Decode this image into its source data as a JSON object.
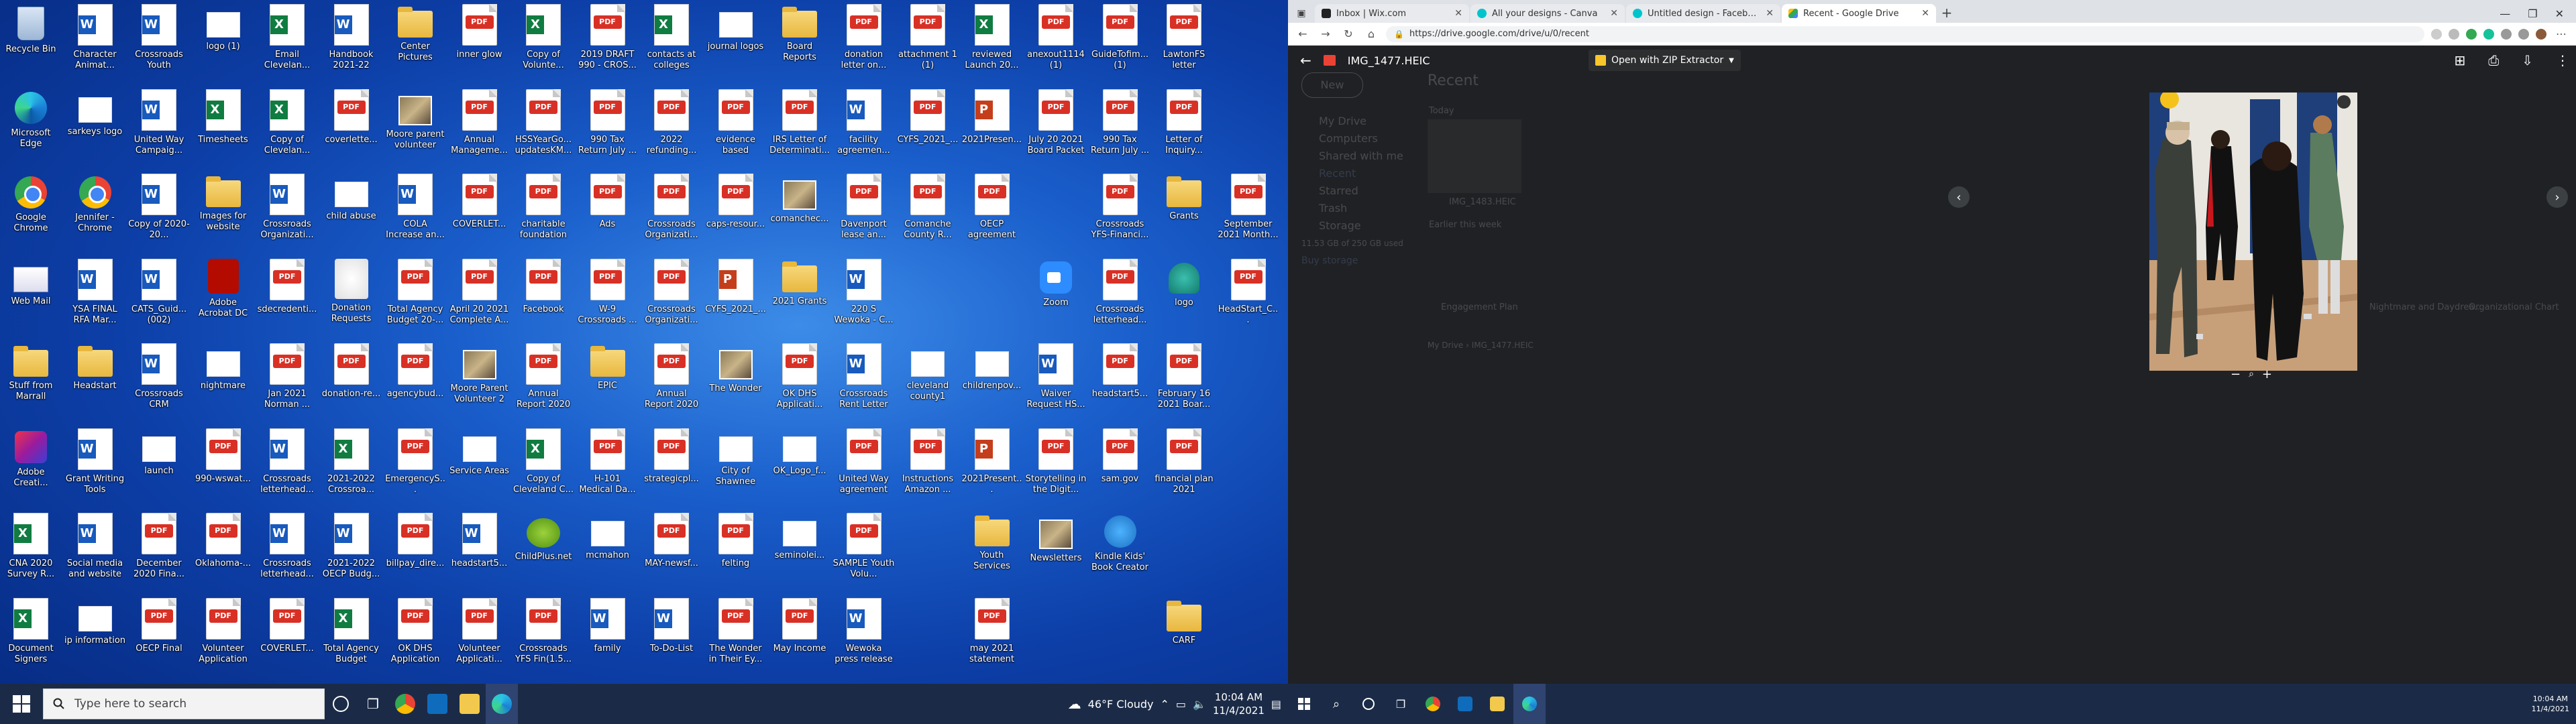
{
  "desktop": {
    "columns": [
      [
        {
          "label": "Recycle Bin",
          "icon": "bin"
        },
        {
          "label": "Microsoft Edge",
          "icon": "edge"
        },
        {
          "label": "Google Chrome",
          "icon": "chrome"
        },
        {
          "label": "Web Mail",
          "icon": "mail"
        },
        {
          "label": "Stuff from Marrall",
          "icon": "folder"
        },
        {
          "label": "Adobe Creati...",
          "icon": "adobe"
        },
        {
          "label": "CNA 2020 Survey R...",
          "icon": "excel"
        },
        {
          "label": "Document Signers",
          "icon": "excel"
        }
      ],
      [
        {
          "label": "Character Animat...",
          "icon": "word"
        },
        {
          "label": "sarkeys logo",
          "icon": "blank"
        },
        {
          "label": "Jennifer - Chrome",
          "icon": "chrome"
        },
        {
          "label": "YSA FINAL RFA Mar...",
          "icon": "word"
        },
        {
          "label": "Headstart",
          "icon": "folder"
        },
        {
          "label": "Grant Writing Tools",
          "icon": "word"
        },
        {
          "label": "Social media and website",
          "icon": "word"
        },
        {
          "label": "ip information",
          "icon": "blank"
        }
      ],
      [
        {
          "label": "Crossroads Youth",
          "icon": "word"
        },
        {
          "label": "United Way Campaig...",
          "icon": "word"
        },
        {
          "label": "Copy of 2020-20...",
          "icon": "word"
        },
        {
          "label": "CATS_Guid... (002)",
          "icon": "word"
        },
        {
          "label": "Crossroads CRM",
          "icon": "word"
        },
        {
          "label": "launch",
          "icon": "blank"
        },
        {
          "label": "December 2020 Fina...",
          "icon": "pdf"
        },
        {
          "label": "OECP Final",
          "icon": "pdf"
        }
      ],
      [
        {
          "label": "logo (1)",
          "icon": "blank"
        },
        {
          "label": "Timesheets",
          "icon": "excel"
        },
        {
          "label": "Images for website",
          "icon": "folder"
        },
        {
          "label": "Adobe Acrobat DC",
          "icon": "acrobat"
        },
        {
          "label": "nightmare",
          "icon": "blank"
        },
        {
          "label": "990-wswat...",
          "icon": "pdf"
        },
        {
          "label": "Oklahoma-...",
          "icon": "pdf"
        },
        {
          "label": "Volunteer Application",
          "icon": "pdf"
        }
      ],
      [
        {
          "label": "Email Clevelan...",
          "icon": "excel"
        },
        {
          "label": "Copy of Clevelan...",
          "icon": "excel"
        },
        {
          "label": "Crossroads Organizati...",
          "icon": "word"
        },
        {
          "label": "sdecredenti...",
          "icon": "pdf"
        },
        {
          "label": "Jan 2021 Norman ...",
          "icon": "pdf"
        },
        {
          "label": "Crossroads letterhead...",
          "icon": "word"
        },
        {
          "label": "Crossroads letterhead...",
          "icon": "word"
        },
        {
          "label": "COVERLET...",
          "icon": "pdf"
        }
      ],
      [
        {
          "label": "Handbook 2021-22",
          "icon": "word"
        },
        {
          "label": "coverlette...",
          "icon": "pdf"
        },
        {
          "label": "child abuse",
          "icon": "blank"
        },
        {
          "label": "Donation Requests",
          "icon": "nf"
        },
        {
          "label": "donation-re...",
          "icon": "pdf"
        },
        {
          "label": "2021-2022 Crossroa...",
          "icon": "excel"
        },
        {
          "label": "2021-2022 OECP Budg...",
          "icon": "word"
        },
        {
          "label": "Total Agency Budget",
          "icon": "excel"
        }
      ],
      [
        {
          "label": "Center Pictures",
          "icon": "folder"
        },
        {
          "label": "Moore parent volunteer",
          "icon": "img"
        },
        {
          "label": "COLA Increase an...",
          "icon": "word"
        },
        {
          "label": "Total Agency Budget 20-...",
          "icon": "pdf"
        },
        {
          "label": "agencybud...",
          "icon": "pdf"
        },
        {
          "label": "EmergencyS...",
          "icon": "pdf"
        },
        {
          "label": "billpay_dire...",
          "icon": "pdf"
        },
        {
          "label": "OK DHS Application",
          "icon": "pdf"
        }
      ],
      [
        {
          "label": "inner glow",
          "icon": "pdf"
        },
        {
          "label": "Annual Manageme...",
          "icon": "pdf"
        },
        {
          "label": "COVERLET...",
          "icon": "pdf"
        },
        {
          "label": "April 20 2021 Complete A...",
          "icon": "pdf"
        },
        {
          "label": "Moore Parent Volunteer 2",
          "icon": "img"
        },
        {
          "label": "Service Areas",
          "icon": "blank"
        },
        {
          "label": "headstart5...",
          "icon": "word"
        },
        {
          "label": "Volunteer Applicati...",
          "icon": "pdf"
        }
      ],
      [
        {
          "label": "Copy of Volunte...",
          "icon": "excel"
        },
        {
          "label": "HSSYearGo... updatesKM...",
          "icon": "pdf"
        },
        {
          "label": "charitable foundation",
          "icon": "pdf"
        },
        {
          "label": "Facebook",
          "icon": "pdf"
        },
        {
          "label": "Annual Report 2020",
          "icon": "pdf"
        },
        {
          "label": "Copy of Cleveland C...",
          "icon": "excel"
        },
        {
          "label": "ChildPlus.net",
          "icon": "net"
        },
        {
          "label": "Crossroads YFS Fin(1.5...",
          "icon": "pdf"
        }
      ],
      [
        {
          "label": "2019 DRAFT 990 - CROS...",
          "icon": "pdf"
        },
        {
          "label": "990 Tax Return July ...",
          "icon": "pdf"
        },
        {
          "label": "Ads",
          "icon": "pdf"
        },
        {
          "label": "W-9 Crossroads ...",
          "icon": "pdf"
        },
        {
          "label": "EPIC",
          "icon": "folder"
        },
        {
          "label": "H-101 Medical Da...",
          "icon": "pdf"
        },
        {
          "label": "mcmahon",
          "icon": "blank"
        },
        {
          "label": "family",
          "icon": "word"
        }
      ],
      [
        {
          "label": "contacts at colleges",
          "icon": "excel"
        },
        {
          "label": "2022 refunding...",
          "icon": "pdf"
        },
        {
          "label": "Crossroads Organizati...",
          "icon": "pdf"
        },
        {
          "label": "Crossroads Organizati...",
          "icon": "pdf"
        },
        {
          "label": "Annual Report 2020",
          "icon": "pdf"
        },
        {
          "label": "strategicpl...",
          "icon": "pdf"
        },
        {
          "label": "MAY-newsf...",
          "icon": "pdf"
        },
        {
          "label": "To-Do-List",
          "icon": "word"
        }
      ],
      [
        {
          "label": "journal logos",
          "icon": "blank"
        },
        {
          "label": "evidence based",
          "icon": "pdf"
        },
        {
          "label": "caps-resour...",
          "icon": "pdf"
        },
        {
          "label": "CYFS_2021_...",
          "icon": "ppt"
        },
        {
          "label": "The Wonder",
          "icon": "img"
        },
        {
          "label": "City of Shawnee",
          "icon": "blank"
        },
        {
          "label": "felting",
          "icon": "pdf"
        },
        {
          "label": "The Wonder in Their Ey...",
          "icon": "pdf"
        }
      ],
      [
        {
          "label": "Board Reports",
          "icon": "folder"
        },
        {
          "label": "IRS Letter of Determinati...",
          "icon": "pdf"
        },
        {
          "label": "comanchec...",
          "icon": "img"
        },
        {
          "label": "2021 Grants",
          "icon": "folder"
        },
        {
          "label": "OK DHS Applicati...",
          "icon": "pdf"
        },
        {
          "label": "OK_Logo_f...",
          "icon": "blank"
        },
        {
          "label": "seminolei...",
          "icon": "blank"
        },
        {
          "label": "May Income",
          "icon": "pdf"
        }
      ],
      [
        {
          "label": "donation letter on...",
          "icon": "pdf"
        },
        {
          "label": "facility agreemen...",
          "icon": "word"
        },
        {
          "label": "Davenport lease an...",
          "icon": "pdf"
        },
        {
          "label": "220 S Wewoka - C...",
          "icon": "word"
        },
        {
          "label": "Crossroads Rent Letter",
          "icon": "word"
        },
        {
          "label": "United Way agreement",
          "icon": "pdf"
        },
        {
          "label": "SAMPLE Youth Volu...",
          "icon": "pdf"
        },
        {
          "label": "Wewoka press release",
          "icon": "word"
        }
      ],
      [
        {
          "label": "attachment 1 (1)",
          "icon": "pdf"
        },
        {
          "label": "CYFS_2021_...",
          "icon": "pdf"
        },
        {
          "label": "Comanche County R...",
          "icon": "pdf"
        },
        {
          "label": "",
          "icon": "none"
        },
        {
          "label": "cleveland county1",
          "icon": "blank"
        },
        {
          "label": "Instructions Amazon ...",
          "icon": "pdf"
        },
        {
          "label": "",
          "icon": "none"
        },
        {
          "label": "",
          "icon": "none"
        }
      ],
      [
        {
          "label": "reviewed Launch 20...",
          "icon": "excel"
        },
        {
          "label": "2021Presen...",
          "icon": "ppt"
        },
        {
          "label": "OECP agreement",
          "icon": "pdf"
        },
        {
          "label": "",
          "icon": "none"
        },
        {
          "label": "childrenpov...",
          "icon": "blank"
        },
        {
          "label": "2021Present...",
          "icon": "ppt"
        },
        {
          "label": "Youth Services",
          "icon": "folder"
        },
        {
          "label": "may 2021 statement",
          "icon": "pdf"
        }
      ],
      [
        {
          "label": "anexout1114 (1)",
          "icon": "pdf"
        },
        {
          "label": "July 20 2021 Board Packet",
          "icon": "pdf"
        },
        {
          "label": "",
          "icon": "none"
        },
        {
          "label": "Zoom",
          "icon": "zoom"
        },
        {
          "label": "Waiver Request HS...",
          "icon": "word"
        },
        {
          "label": "Storytelling in the Digit...",
          "icon": "pdf"
        },
        {
          "label": "Newsletters",
          "icon": "img"
        },
        {
          "label": "",
          "icon": "none"
        }
      ],
      [
        {
          "label": "GuideTofim... (1)",
          "icon": "pdf"
        },
        {
          "label": "990 Tax Return July ...",
          "icon": "pdf"
        },
        {
          "label": "Crossroads YFS-Financi...",
          "icon": "pdf"
        },
        {
          "label": "Crossroads letterhead...",
          "icon": "pdf"
        },
        {
          "label": "headstart5...",
          "icon": "pdf"
        },
        {
          "label": "sam.gov",
          "icon": "pdf"
        },
        {
          "label": "Kindle Kids' Book Creator",
          "icon": "kindle"
        },
        {
          "label": "",
          "icon": "none"
        }
      ],
      [
        {
          "label": "LawtonFS letter",
          "icon": "pdf"
        },
        {
          "label": "Letter of Inquiry...",
          "icon": "pdf"
        },
        {
          "label": "Grants",
          "icon": "folder"
        },
        {
          "label": "logo",
          "icon": "logoicon"
        },
        {
          "label": "February 16 2021 Boar...",
          "icon": "pdf"
        },
        {
          "label": "financial plan 2021",
          "icon": "pdf"
        },
        {
          "label": "",
          "icon": "none"
        },
        {
          "label": "CARF",
          "icon": "folder"
        }
      ],
      [
        {
          "label": "",
          "icon": "none"
        },
        {
          "label": "",
          "icon": "none"
        },
        {
          "label": "September 2021 Month...",
          "icon": "pdf"
        },
        {
          "label": "HeadStart_C...",
          "icon": "pdf"
        },
        {
          "label": "",
          "icon": "none"
        },
        {
          "label": "",
          "icon": "none"
        },
        {
          "label": "",
          "icon": "none"
        },
        {
          "label": "",
          "icon": "none"
        }
      ]
    ]
  },
  "taskbar_left": {
    "search_placeholder": "Type here to search",
    "weather": "46°F  Cloudy",
    "time": "10:04 AM",
    "date": "11/4/2021"
  },
  "browser": {
    "tabs": [
      {
        "title": "Inbox | Wix.com",
        "color": "#222222"
      },
      {
        "title": "All your designs - Canva",
        "color": "#00c4cc"
      },
      {
        "title": "Untitled design - Facebook Post",
        "color": "#00c4cc"
      },
      {
        "title": "Recent - Google Drive",
        "color": "#1fa463"
      }
    ],
    "url": "https://drive.google.com/drive/u/0/recent"
  },
  "viewer": {
    "filename": "IMG_1477.HEIC",
    "open_with": "Open with ZIP Extractor"
  },
  "drive_bg": {
    "new_label": "New",
    "title": "Recent",
    "nav": [
      "My Drive",
      "Computers",
      "Shared with me",
      "Recent",
      "Starred",
      "Trash",
      "Storage"
    ],
    "storage": "11.53 GB of 250 GB used",
    "buy": "Buy storage",
    "today": "Today",
    "earlier": "Earlier this week",
    "file1": "IMG_1483.HEIC",
    "file2": "Engagement Plan",
    "file3": "Nightmare and Daydrea...",
    "file4": "Organizational Chart",
    "breadcrumb": "My Drive",
    "breadcrumb_file": "IMG_1477.HEIC"
  },
  "taskbar_right": {
    "time": "10:04 AM",
    "date": "11/4/2021"
  }
}
